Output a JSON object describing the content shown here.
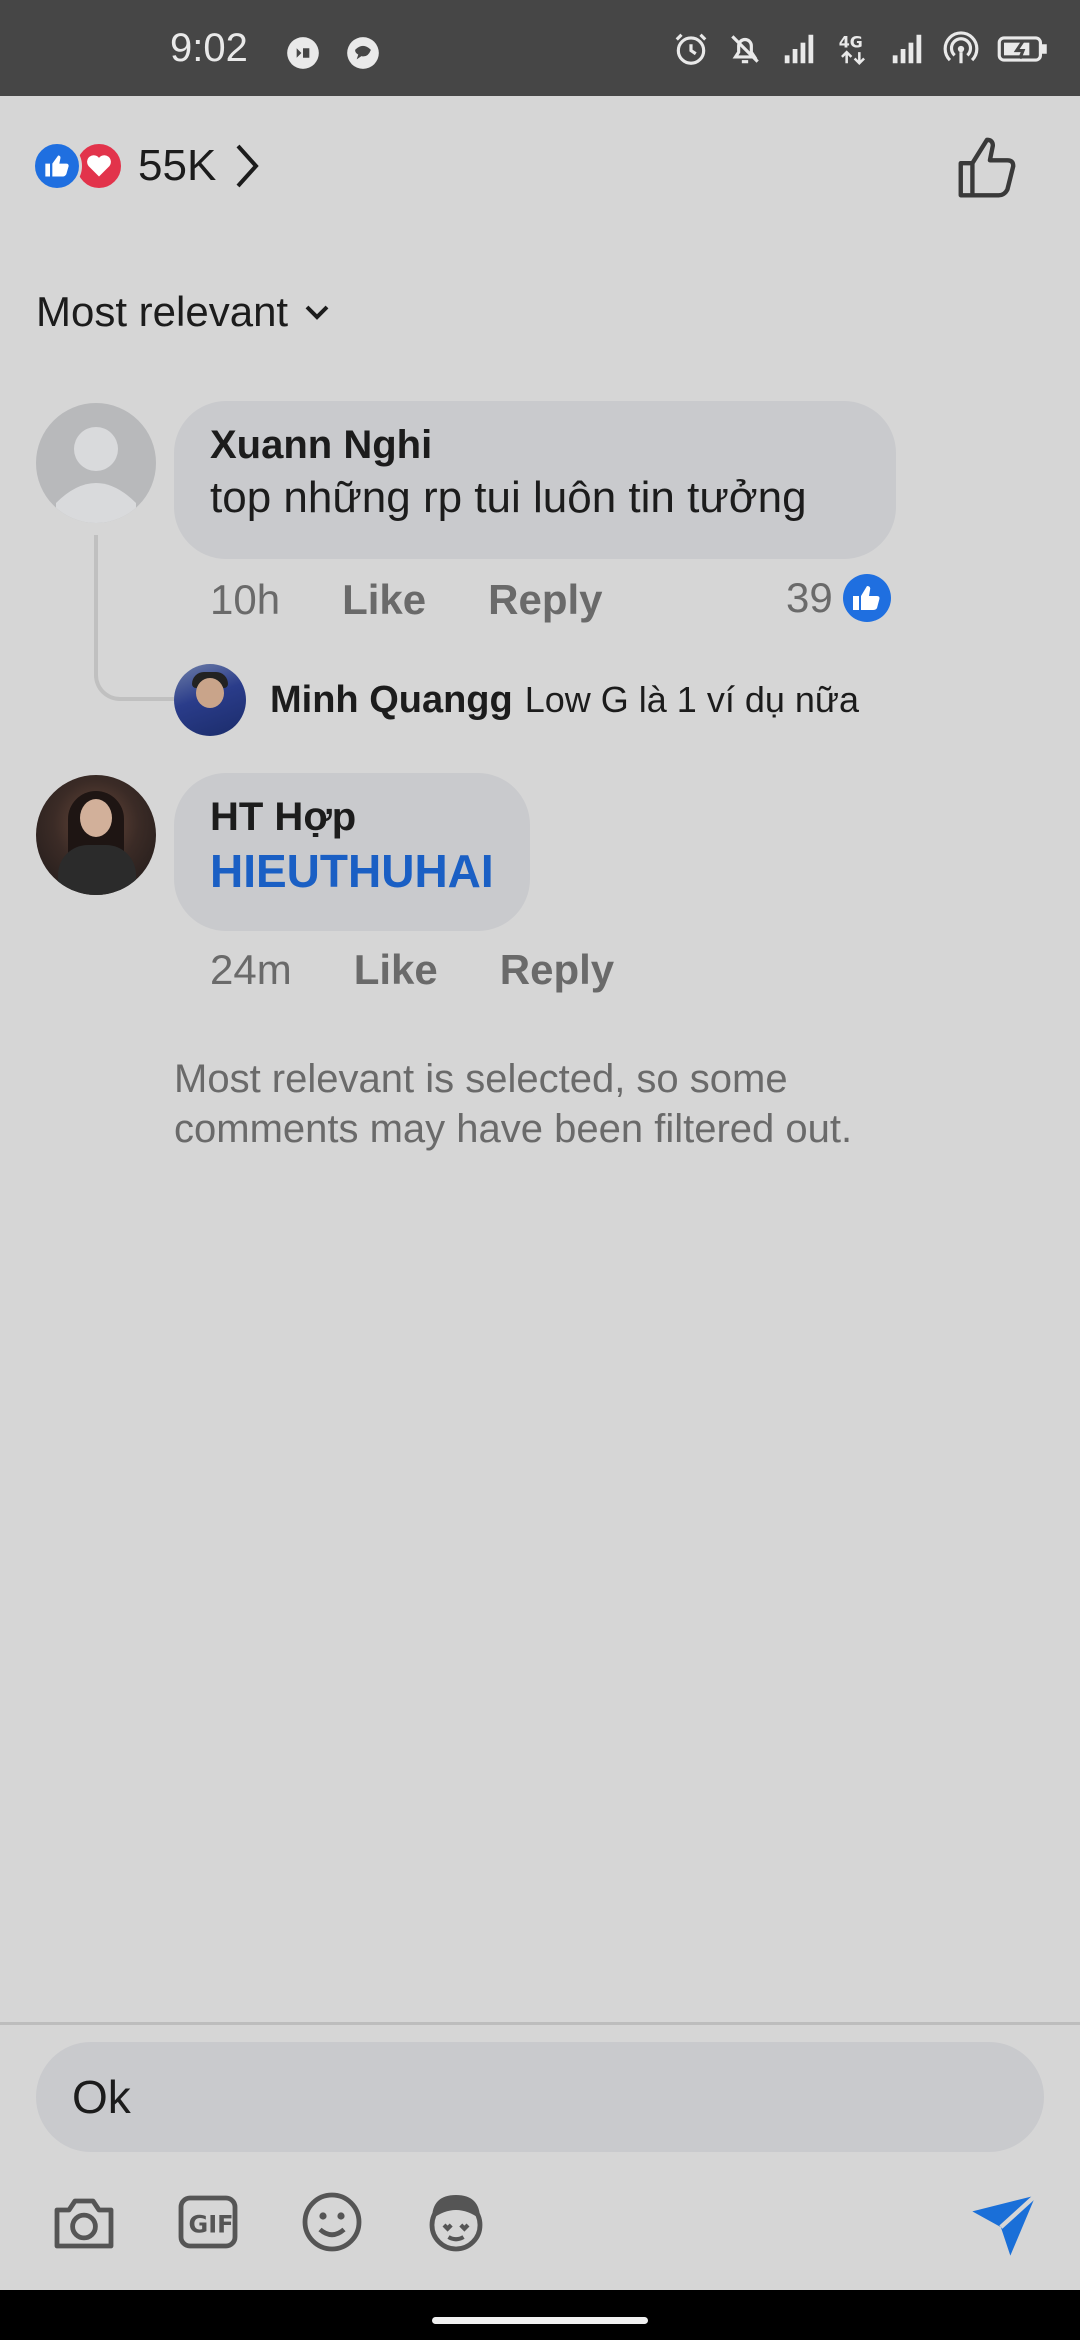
{
  "status_bar": {
    "time": "9:02",
    "left_icons": [
      "messenger-icon",
      "chat-icon"
    ],
    "right_icons": [
      "alarm-icon",
      "notifications-off-icon",
      "signal-icon",
      "network-4g-icon",
      "signal-icon",
      "hotspot-icon",
      "battery-charging-icon"
    ]
  },
  "reactions": {
    "count": "55K",
    "types": [
      "like",
      "love"
    ]
  },
  "sort": {
    "label": "Most relevant"
  },
  "comments": [
    {
      "author": "Xuann Nghi",
      "text": "top những rp tui luôn tin tưởng",
      "time": "10h",
      "like_label": "Like",
      "reply_label": "Reply",
      "like_count": "39",
      "reply": {
        "author": "Minh Quangg",
        "text": "Low G là 1 ví dụ nữa"
      }
    },
    {
      "author": "HT Hợp",
      "text": "HIEUTHUHAI",
      "time": "24m",
      "like_label": "Like",
      "reply_label": "Reply"
    }
  ],
  "notice": "Most relevant is selected, so some comments may have been filtered out.",
  "composer": {
    "value": "Ok",
    "tools": [
      "camera-icon",
      "gif-icon",
      "emoji-icon",
      "avatar-sticker-icon"
    ]
  },
  "colors": {
    "like_blue": "#1f6fe0",
    "love_red": "#e2334b",
    "link_blue": "#1a5fc4",
    "bubble": "#c9cacd",
    "background": "#d6d6d6"
  }
}
